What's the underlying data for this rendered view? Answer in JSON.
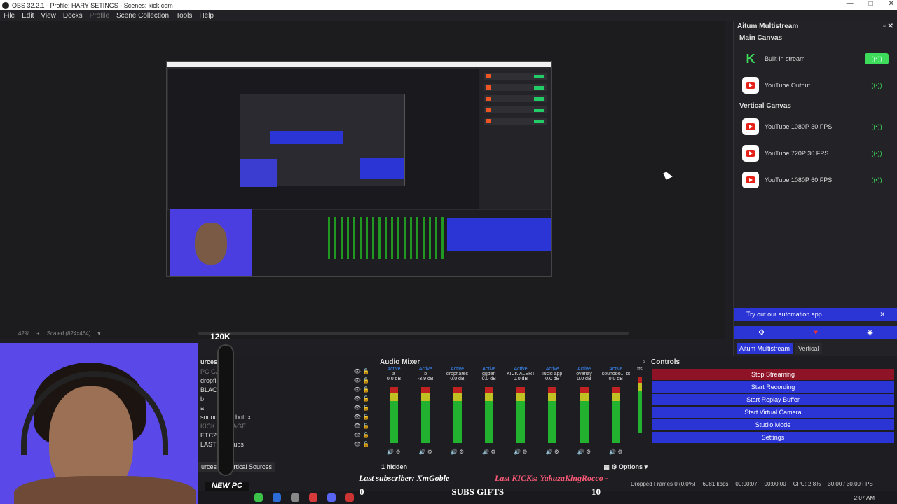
{
  "window": {
    "title": "OBS 32.2.1 - Profile: HARY SETINGS - Scenes: kick.com"
  },
  "menu": [
    "File",
    "Edit",
    "View",
    "Docks",
    "Profile",
    "Scene Collection",
    "Tools",
    "Help"
  ],
  "preview": {
    "zoom": "42%",
    "scaled": "Scaled (824x464)"
  },
  "multistream": {
    "title": "Aitum Multistream",
    "main_canvas": "Main Canvas",
    "vertical_canvas": "Vertical Canvas",
    "main_outputs": [
      {
        "label": "Built-in stream",
        "logo": "kick-logo",
        "active": true
      },
      {
        "label": "YouTube Output",
        "logo": "youtube-logo",
        "active": false
      }
    ],
    "vertical_outputs": [
      {
        "label": "YouTube 1080P 30 FPS"
      },
      {
        "label": "YouTube 720P 30 FPS"
      },
      {
        "label": "YouTube 1080P 60 FPS"
      }
    ],
    "promo": "Try out our automation app",
    "tabs": [
      "Aitum Multistream",
      "Vertical"
    ]
  },
  "goal": {
    "count": "120K",
    "label": "NEW PC GOAL"
  },
  "sources": {
    "header": "urces",
    "items": [
      {
        "label": "PC GAOL",
        "dim": true
      },
      {
        "label": "dropflares",
        "dim": false
      },
      {
        "label": "BLACK",
        "dim": false
      },
      {
        "label": "b",
        "dim": false
      },
      {
        "label": "a",
        "dim": false
      },
      {
        "label": "soundboard botrix",
        "dim": false
      },
      {
        "label": "KICK AL IMAGE",
        "dim": true
      },
      {
        "label": "ETC2",
        "dim": false
      },
      {
        "label": "LAST kick subs",
        "dim": false
      }
    ],
    "tabs": [
      "urces",
      "Vertical Sources"
    ]
  },
  "mixer": {
    "title": "Audio Mixer",
    "channels": [
      {
        "name": "a",
        "active": "Active",
        "db": "0.0 dB"
      },
      {
        "name": "b",
        "active": "Active",
        "db": "-3.9 dB"
      },
      {
        "name": "dropflares",
        "active": "Active",
        "db": "0.0 dB"
      },
      {
        "name": "ggden",
        "active": "Active",
        "db": "0.0 dB"
      },
      {
        "name": "KICK ALERTS",
        "active": "Active",
        "db": "0.0 dB"
      },
      {
        "name": "lucid app",
        "active": "Active",
        "db": "0.0 dB"
      },
      {
        "name": "overlay",
        "active": "Active",
        "db": "0.0 dB"
      },
      {
        "name": "soundbo... botrix",
        "active": "Active",
        "db": "0.0 dB"
      },
      {
        "name": "tts",
        "active": "",
        "db": ""
      }
    ],
    "hidden": "1 hidden",
    "options": "Options"
  },
  "controls": {
    "title": "Controls",
    "buttons": [
      "Stop Streaming",
      "Start Recording",
      "Start Replay Buffer",
      "Start Virtual Camera",
      "Studio Mode",
      "Settings"
    ]
  },
  "overlay": {
    "last_subscriber": "Last subscriber: XmGoble",
    "last_kicks": "Last KICKs: YakuzaKingRocco -",
    "subs_left": "0",
    "subs_title": "SUBS GIFTS",
    "subs_right": "10"
  },
  "status": {
    "dropped": "Dropped Frames 0 (0.0%)",
    "bitrate": "6081 kbps",
    "stream_time": "00:00:07",
    "rec_time": "00:00:00",
    "cpu": "CPU: 2.8%",
    "fps": "30.00 / 30.00 FPS"
  },
  "taskbar": {
    "time": "2:07 AM"
  }
}
